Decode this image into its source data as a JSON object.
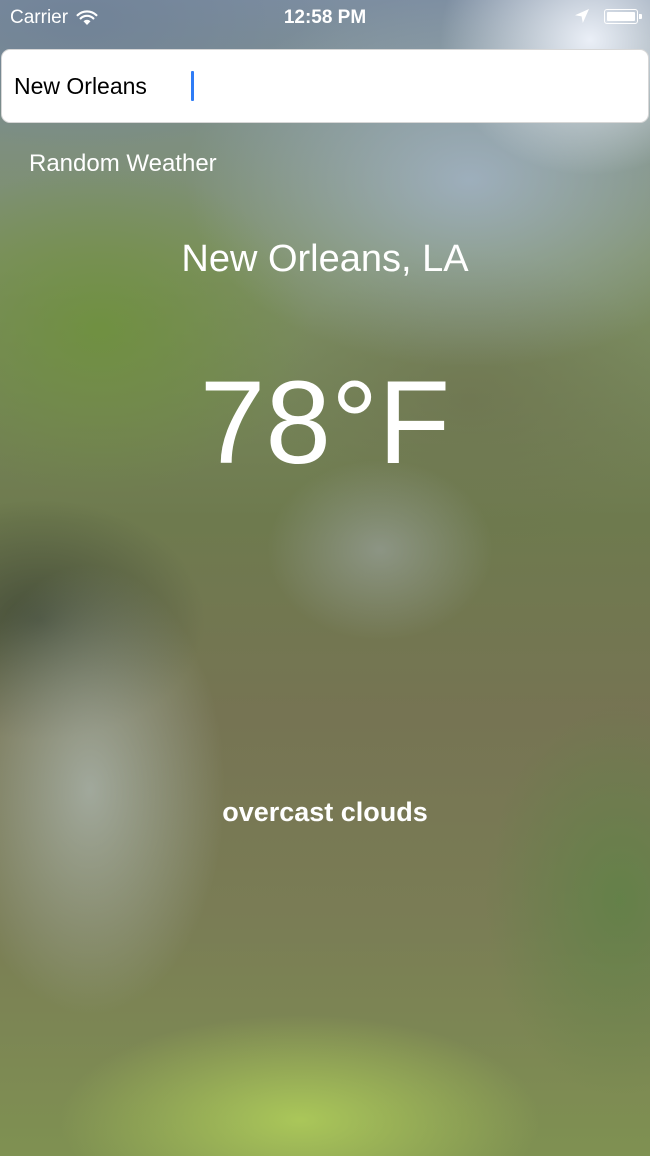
{
  "status_bar": {
    "carrier": "Carrier",
    "time": "12:58 PM",
    "battery_level": 1.0,
    "icons": [
      "wifi-icon",
      "location-arrow-icon",
      "battery-icon"
    ]
  },
  "search": {
    "value": "New Orleans",
    "caret_color": "#2f7cf6"
  },
  "random_weather_label": "Random Weather",
  "weather": {
    "city": "New Orleans, LA",
    "temperature": "78°F",
    "condition": "overcast clouds"
  },
  "colors": {
    "text": "#ffffff",
    "search_background": "#ffffff"
  }
}
